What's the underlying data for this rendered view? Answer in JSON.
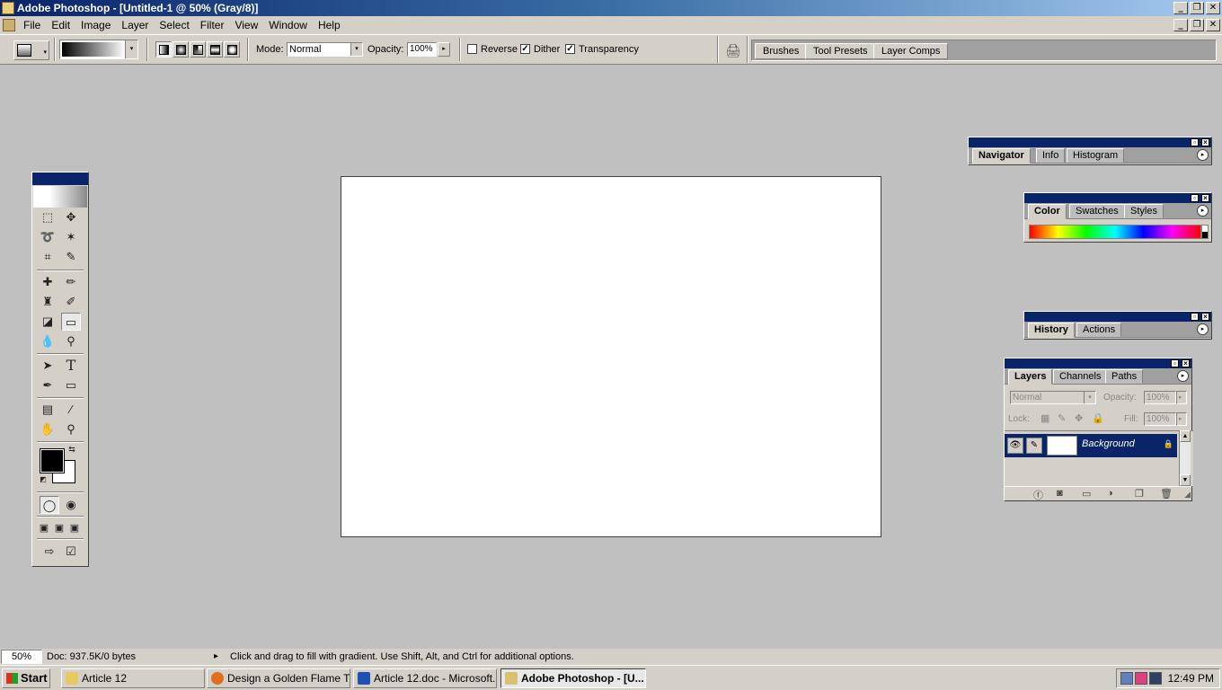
{
  "window": {
    "title": "Adobe Photoshop - [Untitled-1 @ 50% (Gray/8)]",
    "buttons": [
      "_",
      "❐",
      "✕"
    ]
  },
  "menu": {
    "items": [
      "File",
      "Edit",
      "Image",
      "Layer",
      "Select",
      "Filter",
      "View",
      "Window",
      "Help"
    ]
  },
  "options": {
    "mode_label": "Mode:",
    "mode_value": "Normal",
    "opacity_label": "Opacity:",
    "opacity_value": "100%",
    "reverse_label": "Reverse",
    "reverse_checked": false,
    "dither_label": "Dither",
    "dither_checked": true,
    "transparency_label": "Transparency",
    "transparency_checked": true,
    "check_mark": "✓",
    "arrow": "▸",
    "dropdown": "▾"
  },
  "palette_well": {
    "tabs": [
      "Brushes",
      "Tool Presets",
      "Layer Comps"
    ]
  },
  "navigator_palette": {
    "tabs": [
      "Navigator",
      "Info",
      "Histogram"
    ]
  },
  "color_palette": {
    "tabs": [
      "Color",
      "Swatches",
      "Styles"
    ]
  },
  "history_palette": {
    "tabs": [
      "History",
      "Actions"
    ]
  },
  "layers_palette": {
    "tabs": [
      "Layers",
      "Channels",
      "Paths"
    ],
    "blend_mode": "Normal",
    "opacity_label": "Opacity:",
    "opacity_value": "100%",
    "lock_label": "Lock:",
    "fill_label": "Fill:",
    "fill_value": "100%",
    "layers": [
      {
        "name": "Background",
        "visible": true,
        "locked": true
      }
    ]
  },
  "status": {
    "zoom": "50%",
    "doc_info": "Doc: 937.5K/0 bytes",
    "hint": "Click and drag to fill with gradient.  Use Shift, Alt, and Ctrl for additional options."
  },
  "taskbar": {
    "start_label": "Start",
    "buttons": [
      {
        "label": "Article 12",
        "icon": "folder-icon",
        "active": false
      },
      {
        "label": "Design a Golden Flame T...",
        "icon": "firefox-icon",
        "active": false
      },
      {
        "label": "Article 12.doc - Microsoft...",
        "icon": "word-icon",
        "active": false
      },
      {
        "label": "Adobe Photoshop - [U...",
        "icon": "photoshop-icon",
        "active": true
      }
    ],
    "clock": "12:49 PM"
  }
}
